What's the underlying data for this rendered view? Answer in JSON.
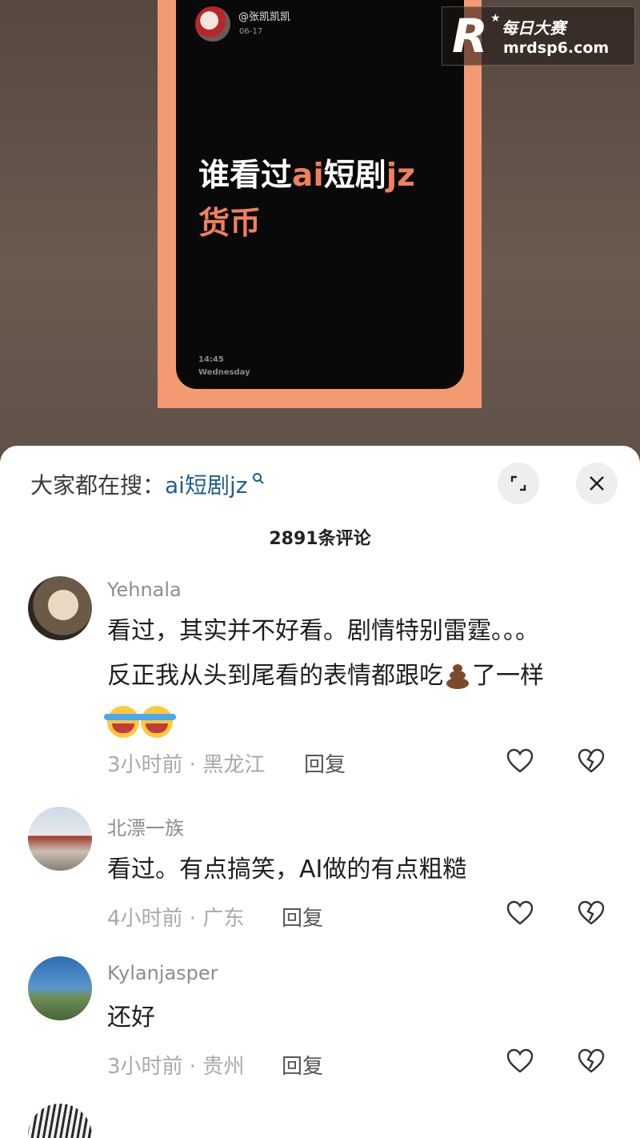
{
  "post": {
    "username": "@张凯凯凯",
    "date": "06-17",
    "headline_white_1": "谁看过",
    "headline_accent_1": "ai",
    "headline_white_2": "短剧",
    "headline_accent_2": "jz",
    "headline_accent_3": "货币",
    "time": "14:45",
    "weekday": "Wednesday"
  },
  "watermark": {
    "brand": "每日大赛",
    "site": "mrdsp6.com",
    "mark": "R"
  },
  "sheet": {
    "search_prefix": "大家都在搜：",
    "search_keyword": "ai短剧jz",
    "comment_count": "2891条评论"
  },
  "comments": [
    {
      "name": "Yehnala",
      "line1": "看过，其实并不好看。剧情特别雷霆。。。",
      "line2a": "反正我从头到尾看的表情都跟吃",
      "line2b": "了一样",
      "meta": "3小时前 · 黑龙江",
      "reply": "回复"
    },
    {
      "name": "北漂一族",
      "text": "看过。有点搞笑，AI做的有点粗糙",
      "meta": "4小时前 · 广东",
      "reply": "回复"
    },
    {
      "name": "Kylanjasper",
      "text": "还好",
      "meta": "3小时前 · 贵州",
      "reply": "回复"
    }
  ],
  "icons": [
    "expand-icon",
    "close-icon",
    "search-icon",
    "heart-icon",
    "broken-heart-icon",
    "crying-laughing-emoji",
    "poop-emoji"
  ]
}
